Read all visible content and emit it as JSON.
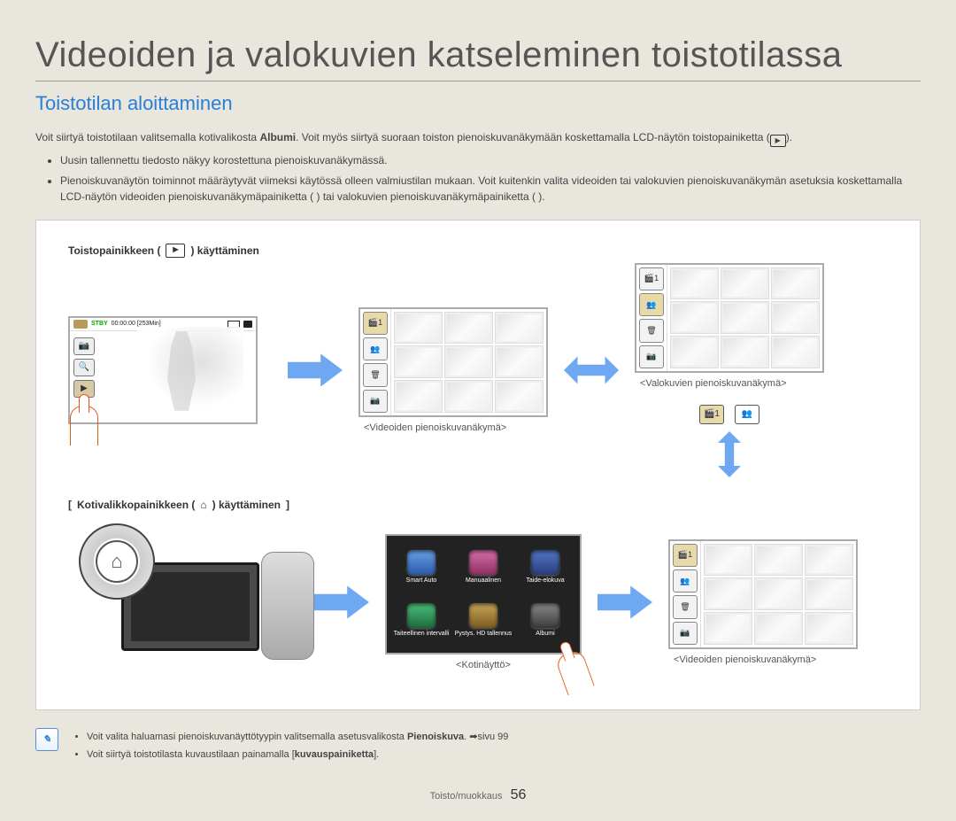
{
  "title": "Videoiden ja valokuvien katseleminen toistotilassa",
  "subtitle": "Toistotilan aloittaminen",
  "intro_pre": "Voit siirtyä toistotilaan valitsemalla kotivalikosta ",
  "intro_bold1": "Albumi",
  "intro_post": ". Voit myös siirtyä suoraan toiston pienoiskuvanäkymään koskettamalla LCD-näytön toistopainiketta (",
  "intro_end": ").",
  "bullets": [
    "Uusin tallennettu tiedosto näkyy korostettuna pienoiskuvanäkymässä.",
    "Pienoiskuvanäytön toiminnot määräytyvät viimeksi käytössä olleen valmiustilan mukaan. Voit kuitenkin valita videoiden tai valokuvien pienoiskuvanäkymän asetuksia koskettamalla LCD-näytön videoiden pienoiskuvanäkymäpainiketta (    ) tai valokuvien pienoiskuvanäkymäpainiketta (    )."
  ],
  "section1_caption_pre": "Toistopainikkeen (",
  "section1_caption_post": ") käyttäminen",
  "section2_caption_pre": "Kotivalikkopainikkeen (",
  "section2_caption_post": ") käyttäminen",
  "home_items": [
    {
      "label": "Smart Auto",
      "color": "linear-gradient(#6aa0e8,#2c5aa8)"
    },
    {
      "label": "Manuaalinen",
      "color": "linear-gradient(#d96fa9,#8f2e63)"
    },
    {
      "label": "Taide-elokuva",
      "color": "linear-gradient(#5478c9,#2a3d7a)"
    },
    {
      "label": "Taiteellinen intervalli",
      "color": "linear-gradient(#4bc07b,#1e6a3e)"
    },
    {
      "label": "Pystys. HD tallennus",
      "color": "linear-gradient(#caa75a,#7a5b20)"
    },
    {
      "label": "Albumi",
      "color": "linear-gradient(#8a8a8a,#3a3a3a)"
    }
  ],
  "captions": {
    "video_thumb": "<Videoiden pienoiskuvanäkymä>",
    "photo_thumb": "<Valokuvien pienoiskuvanäkymä>",
    "home": "<Kotinäyttö>",
    "video_thumb2": "<Videoiden pienoiskuvanäkymä>"
  },
  "lcd": {
    "stby": "STBY",
    "timecode": "00:00:00 [253Min]",
    "sidebar_icons": [
      "📷",
      "🔍",
      "▶"
    ]
  },
  "thumb_sidebar_icons": [
    "🎬1",
    "👥",
    "🗑",
    "📷"
  ],
  "tabs": [
    "🎬1",
    "👥"
  ],
  "notes": [
    {
      "pre": "Voit valita haluamasi pienoiskuvanäyttötyypin valitsemalla asetusvalikosta ",
      "bold": "Pienoiskuva",
      "post": ". ➡sivu 99"
    },
    {
      "pre": "Voit siirtyä toistotilasta kuvaustilaan painamalla [",
      "bold": "kuvauspainiketta",
      "post": "]."
    }
  ],
  "footer_label": "Toisto/muokkaus",
  "page_number": "56"
}
